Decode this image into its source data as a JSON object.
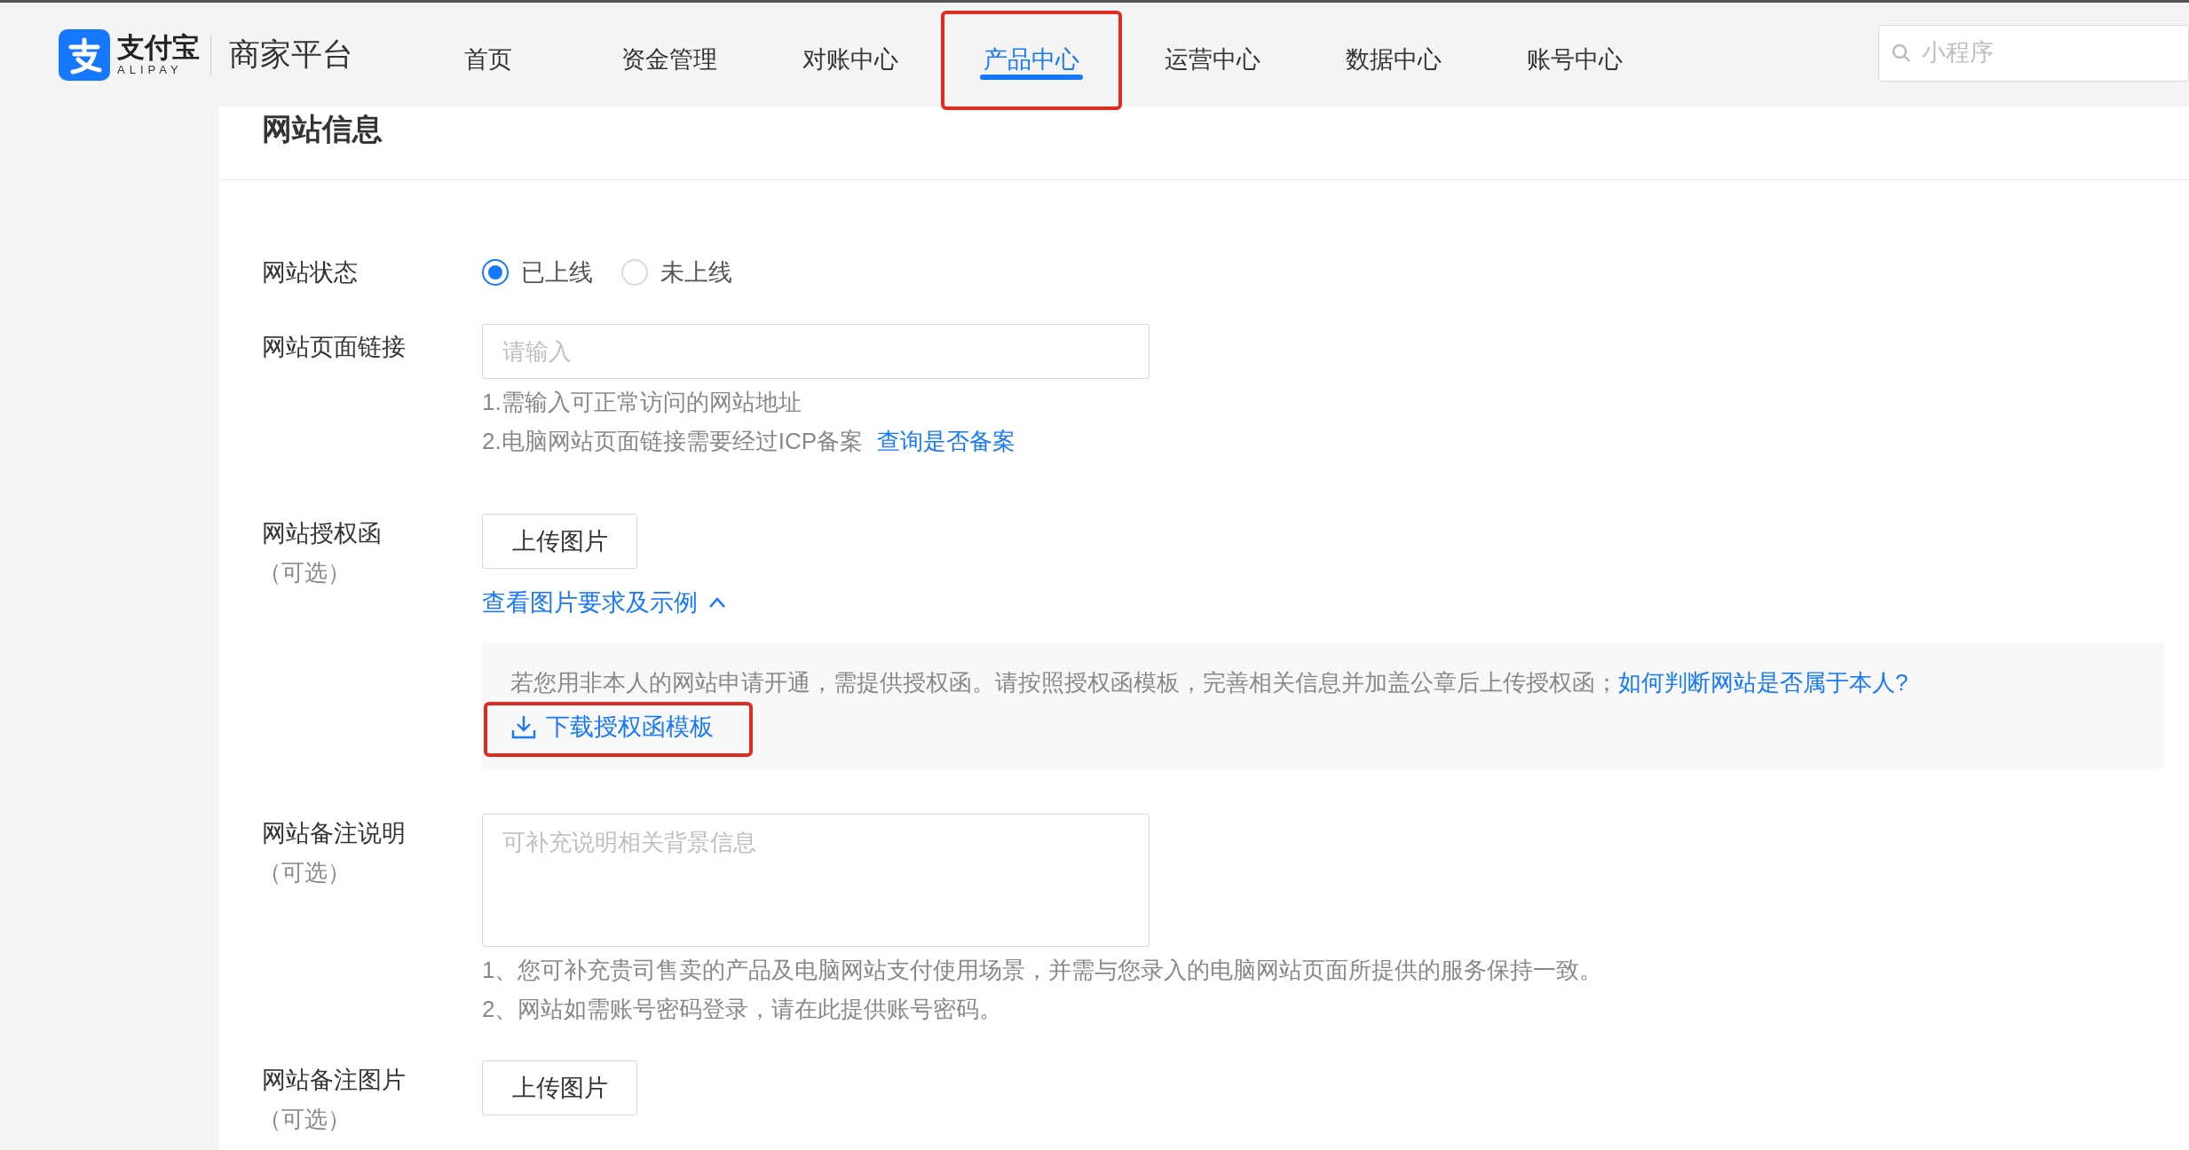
{
  "header": {
    "logo_text": "支付宝",
    "logo_sub": "ALIPAY",
    "platform": "商家平台",
    "nav": [
      {
        "label": "首页",
        "selected": false,
        "highlighted": false
      },
      {
        "label": "资金管理",
        "selected": false,
        "highlighted": false
      },
      {
        "label": "对账中心",
        "selected": false,
        "highlighted": false
      },
      {
        "label": "产品中心",
        "selected": true,
        "highlighted": true
      },
      {
        "label": "运营中心",
        "selected": false,
        "highlighted": false
      },
      {
        "label": "数据中心",
        "selected": false,
        "highlighted": false
      },
      {
        "label": "账号中心",
        "selected": false,
        "highlighted": false
      }
    ],
    "search": {
      "placeholder": "小程序"
    }
  },
  "section_title": "网站信息",
  "form": [
    {
      "kind": "radio",
      "label": "网站状态",
      "options": [
        {
          "label": "已上线",
          "selected": true
        },
        {
          "label": "未上线",
          "selected": false
        }
      ]
    },
    {
      "kind": "input",
      "label": "网站页面链接",
      "placeholder": "请输入",
      "hints": [
        {
          "text": "1.需输入可正常访问的网站地址"
        },
        {
          "text": "2.电脑网站页面链接需要经过ICP备案",
          "link": "查询是否备案"
        }
      ]
    },
    {
      "kind": "upload",
      "label": "网站授权函",
      "optional": "（可选）",
      "button": "上传图片",
      "toggle": "查看图片要求及示例",
      "notice": {
        "text": "若您用非本人的网站申请开通，需提供授权函。请按照授权函模板，完善相关信息并加盖公章后上传授权函；",
        "link": "如何判断网站是否属于本人?",
        "download": "下载授权函模板",
        "highlighted": true
      }
    },
    {
      "kind": "textarea",
      "label": "网站备注说明",
      "optional": "（可选）",
      "placeholder": "可补充说明相关背景信息",
      "hints": [
        {
          "text": "1、您可补充贵司售卖的产品及电脑网站支付使用场景，并需与您录入的电脑网站页面所提供的服务保持一致。"
        },
        {
          "text": "2、网站如需账号密码登录，请在此提供账号密码。"
        }
      ]
    },
    {
      "kind": "upload",
      "label": "网站备注图片",
      "optional": "（可选）",
      "button": "上传图片"
    }
  ]
}
